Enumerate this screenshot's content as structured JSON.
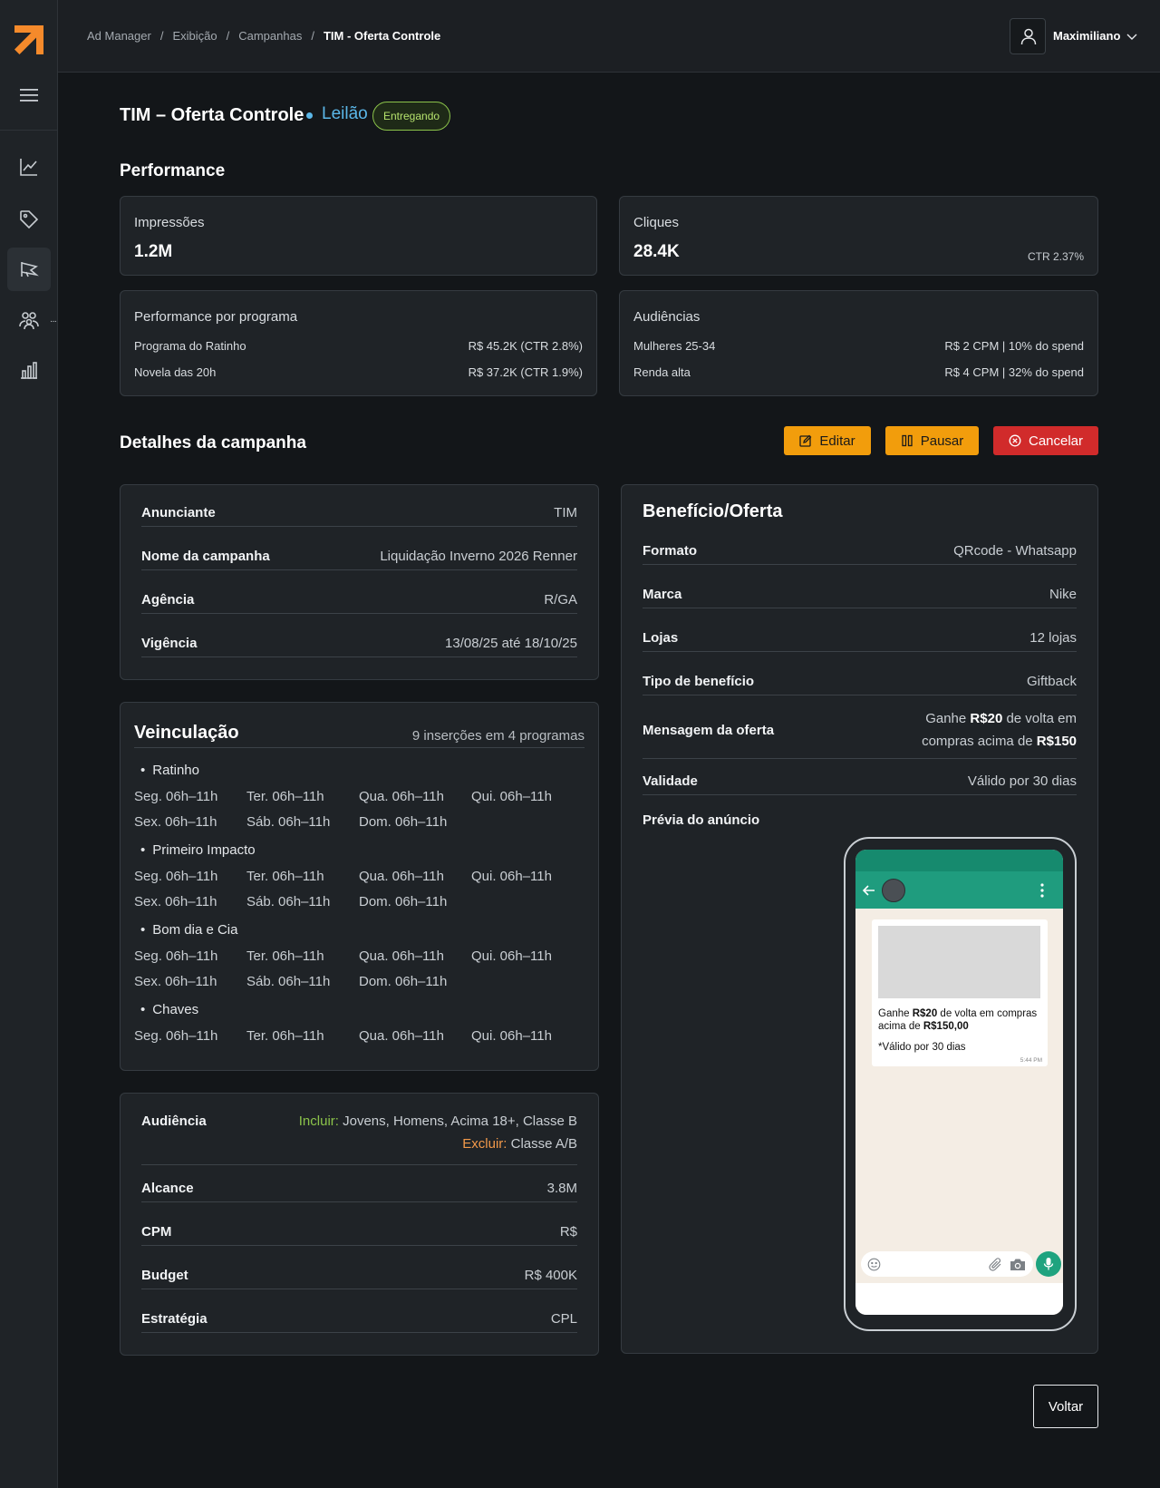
{
  "user": {
    "name": "Maximiliano"
  },
  "breadcrumb": [
    "Ad Manager",
    "Exibição",
    "Campanhas",
    "TIM - Oferta Controle"
  ],
  "campaign": {
    "title": "TIM – Oferta Controle",
    "mode": "Leilão",
    "status": "Entregando"
  },
  "performance": {
    "title": "Performance",
    "impressions": {
      "label": "Impressões",
      "value": "1.2M"
    },
    "clicks": {
      "label": "Cliques",
      "value": "28.4K",
      "ctr": "CTR 2.37%"
    },
    "by_program": {
      "label": "Performance por programa",
      "rows": [
        {
          "name": "Programa do Ratinho",
          "value": "R$ 45.2K (CTR 2.8%)"
        },
        {
          "name": "Novela das 20h",
          "value": "R$ 37.2K (CTR 1.9%)"
        }
      ]
    },
    "audiences": {
      "label": "Audiências",
      "rows": [
        {
          "name": "Mulheres 25-34",
          "value": "R$ 2 CPM | 10% do spend"
        },
        {
          "name": "Renda alta",
          "value": "R$ 4 CPM | 32% do spend"
        }
      ]
    }
  },
  "details": {
    "title": "Detalhes da campanha",
    "actions": {
      "edit": "Editar",
      "pause": "Pausar",
      "cancel": "Cancelar"
    },
    "info": [
      {
        "label": "Anunciante",
        "value": "TIM"
      },
      {
        "label": "Nome da campanha",
        "value": "Liquidação Inverno 2026 Renner"
      },
      {
        "label": "Agência",
        "value": "R/GA"
      },
      {
        "label": "Vigência",
        "value": "13/08/25 até 18/10/25"
      }
    ],
    "veiculacao": {
      "title": "Veinculação",
      "summary": "9 inserções em 4 programas",
      "programs": [
        {
          "name": "Ratinho",
          "slots": [
            "Seg. 06h–11h",
            "Ter. 06h–11h",
            "Qua. 06h–11h",
            "Qui. 06h–11h",
            "Sex. 06h–11h",
            "Sáb. 06h–11h",
            "Dom. 06h–11h"
          ]
        },
        {
          "name": "Primeiro Impacto",
          "slots": [
            "Seg. 06h–11h",
            "Ter. 06h–11h",
            "Qua. 06h–11h",
            "Qui. 06h–11h",
            "Sex. 06h–11h",
            "Sáb. 06h–11h",
            "Dom. 06h–11h"
          ]
        },
        {
          "name": "Bom dia e Cia",
          "slots": [
            "Seg. 06h–11h",
            "Ter. 06h–11h",
            "Qua. 06h–11h",
            "Qui. 06h–11h",
            "Sex. 06h–11h",
            "Sáb. 06h–11h",
            "Dom. 06h–11h"
          ]
        },
        {
          "name": "Chaves",
          "slots": [
            "Seg. 06h–11h",
            "Ter. 06h–11h",
            "Qua. 06h–11h",
            "Qui. 06h–11h"
          ]
        }
      ]
    },
    "audience": {
      "label": "Audiência",
      "include_label": "Incluir:",
      "include_value": "Jovens, Homens, Acima 18+, Classe B",
      "exclude_label": "Excluir:",
      "exclude_value": "Classe A/B"
    },
    "metrics": [
      {
        "label": "Alcance",
        "value": "3.8M"
      },
      {
        "label": "CPM",
        "value": "R$"
      },
      {
        "label": "Budget",
        "value": "R$ 400K"
      },
      {
        "label": "Estratégia",
        "value": "CPL"
      }
    ]
  },
  "offer": {
    "title": "Benefício/Oferta",
    "rows": [
      {
        "label": "Formato",
        "value": "QRcode - Whatsapp"
      },
      {
        "label": "Marca",
        "value": "Nike"
      },
      {
        "label": "Lojas",
        "value": "12 lojas"
      },
      {
        "label": "Tipo de benefício",
        "value": "Giftback"
      }
    ],
    "message": {
      "label": "Mensagem da oferta",
      "line1_pre": "Ganhe ",
      "line1_amount": "R$20",
      "line1_post": " de volta em",
      "line2_pre": "compras acima de ",
      "line2_amount": "R$150"
    },
    "validity": {
      "label": "Validade",
      "value": "Válido por 30 dias"
    },
    "preview": {
      "label": "Prévia do anúncio",
      "text_pre": "Ganhe ",
      "text_amount": "R$20",
      "text_mid": " de volta em compras acima de ",
      "text_amount2": "R$150,00",
      "validity": "*Válido por 30 dias",
      "time": "5:44 PM"
    }
  },
  "footer": {
    "back": "Voltar"
  },
  "colors": {
    "accent": "#f29d0c",
    "danger": "#d12b2b",
    "status": "#8bc34a",
    "mode": "#5bb7e8",
    "logo": "#f58a2b"
  }
}
